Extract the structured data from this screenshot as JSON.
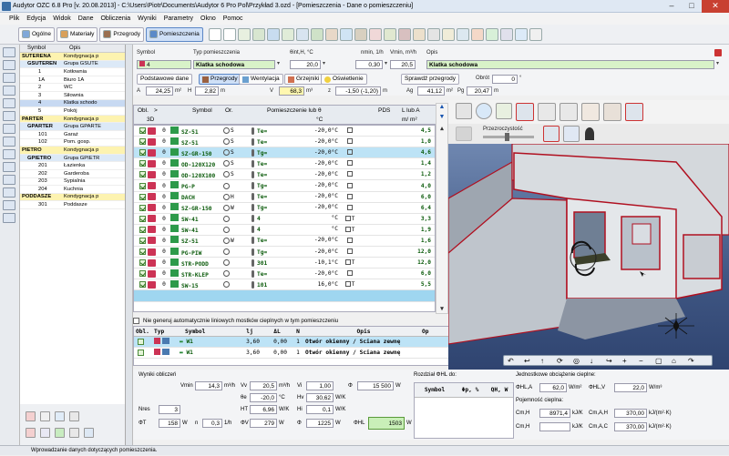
{
  "window": {
    "title": "Audytor OZC 6.8 Pro [v. 20.08.2013] - C:\\Users\\Piotr\\Documents\\Audytor 6 Pro Pol\\Przykład 3.ozd - [Pomieszczenia - Dane o pomieszczeniu]"
  },
  "menu": [
    "Plik",
    "Edycja",
    "Widok",
    "Dane",
    "Obliczenia",
    "Wyniki",
    "Parametry",
    "Okno",
    "Pomoc"
  ],
  "toolbar": {
    "tabs": [
      "Ogólne",
      "Materiały",
      "Przegrody",
      "Pomieszczenia"
    ],
    "active_tab": "Pomieszczenia",
    "zoom": "7 : 28"
  },
  "tree": {
    "col_symbol": "Symbol",
    "col_opis": "Opis",
    "rows": [
      {
        "level": 0,
        "symbol": "SUTERENA",
        "opis": "Kondygnacja p"
      },
      {
        "level": 1,
        "symbol": "GSUTEREN",
        "opis": "Grupa GSUTE"
      },
      {
        "level": 2,
        "symbol": "1",
        "opis": "Kotłownia"
      },
      {
        "level": 2,
        "symbol": "1A",
        "opis": "Biuro 1A"
      },
      {
        "level": 2,
        "symbol": "2",
        "opis": "WC"
      },
      {
        "level": 2,
        "symbol": "3",
        "opis": "Siłownia"
      },
      {
        "level": 2,
        "symbol": "4",
        "opis": "Klatka schodo",
        "selected": true
      },
      {
        "level": 2,
        "symbol": "5",
        "opis": "Pokój"
      },
      {
        "level": 0,
        "symbol": "PARTER",
        "opis": "Kondygnacja p"
      },
      {
        "level": 1,
        "symbol": "GPARTER",
        "opis": "Grupa GPARTE"
      },
      {
        "level": 2,
        "symbol": "101",
        "opis": "Garaż"
      },
      {
        "level": 2,
        "symbol": "102",
        "opis": "Pom. gosp."
      },
      {
        "level": 0,
        "symbol": "PIETRO",
        "opis": "Kondygnacja p"
      },
      {
        "level": 1,
        "symbol": "GPIETRO",
        "opis": "Grupa GPIETR"
      },
      {
        "level": 2,
        "symbol": "201",
        "opis": "Łazienka"
      },
      {
        "level": 2,
        "symbol": "202",
        "opis": "Garderoba"
      },
      {
        "level": 2,
        "symbol": "203",
        "opis": "Sypialnia"
      },
      {
        "level": 2,
        "symbol": "204",
        "opis": "Kuchnia"
      },
      {
        "level": 0,
        "symbol": "PODDASZE",
        "opis": "Kondygnacja p"
      },
      {
        "level": 2,
        "symbol": "301",
        "opis": "Poddasze"
      }
    ]
  },
  "room_form": {
    "lbl_symbol": "Symbol",
    "symbol": "4",
    "lbl_typ": "Typ pomieszczenia",
    "typ": "Klatka schodowa",
    "lbl_theta": "θint,H, °C",
    "theta": "20,0",
    "lbl_nmin": "nmin, 1/h",
    "nmin": "0,30",
    "lbl_vmin": "Vmin, m³/h",
    "vmin": "20,5",
    "lbl_opis": "Opis",
    "opis": "Klatka schodowa",
    "btn_podst": "Podstawowe dane",
    "btn_przegrody": "Przegrody",
    "btn_went": "Wentylacja",
    "btn_grzejniki": "Grzejniki",
    "btn_oswietlenie": "Oświetlenie",
    "btn_sprawdz": "Sprawdź przegrody",
    "lbl_obrot": "Obrót",
    "obrot": "0",
    "lbl_A": "A",
    "A": "24,25",
    "u_m2": "m²",
    "lbl_H": "H",
    "H": "2,82",
    "lbl_V": "V",
    "V": "68,3",
    "u_m3": "m³",
    "lbl_z": "z",
    "z": "-1,50 (-1,20)",
    "lbl_Ag": "Ag",
    "Ag": "41,12",
    "lbl_Pg": "Pg",
    "Pg": "20,47",
    "u_m": "m"
  },
  "partitions": {
    "hdr_obl": "Obl.",
    "hdr_arrow": ">",
    "hdr_3d": "3D",
    "hdr_symbol": "Symbol",
    "hdr_or": "Or.",
    "hdr_adj": "Pomieszczenie lub θ",
    "hdr_unit": "°C",
    "hdr_pds": "PDS",
    "hdr_l": "L lub A",
    "hdr_l_unit": "m/ m²",
    "rows": [
      {
        "n": "0",
        "sym": "SZ-51",
        "or": "S",
        "adj": "Te=",
        "theta": "-20,0°C",
        "pds": "",
        "val": "4,5",
        "style": ""
      },
      {
        "n": "0",
        "sym": "SZ-51",
        "or": "S",
        "adj": "Te=",
        "theta": "-20,0°C",
        "pds": "",
        "val": "1,0",
        "style": ""
      },
      {
        "n": "0",
        "sym": "SZ-GR-150",
        "or": "S",
        "adj": "Tg=",
        "theta": "-20,0°C",
        "pds": "",
        "val": "4,6",
        "style": "hl"
      },
      {
        "n": "0",
        "sym": "OD-120X120",
        "or": "S",
        "adj": "Te=",
        "theta": "-20,0°C",
        "pds": "",
        "val": "1,4",
        "style": ""
      },
      {
        "n": "0",
        "sym": "OD-120X100",
        "or": "S",
        "adj": "Te=",
        "theta": "-20,0°C",
        "pds": "",
        "val": "1,2",
        "style": ""
      },
      {
        "n": "0",
        "sym": "PG-P",
        "or": "",
        "adj": "Tg=",
        "theta": "-20,0°C",
        "pds": "",
        "val": "4,0",
        "style": ""
      },
      {
        "n": "0",
        "sym": "DACH",
        "or": "H",
        "adj": "Te=",
        "theta": "-20,0°C",
        "pds": "",
        "val": "6,0",
        "style": ""
      },
      {
        "n": "0",
        "sym": "SZ-GR-150",
        "or": "W",
        "adj": "Tg=",
        "theta": "-20,0°C",
        "pds": "",
        "val": "6,4",
        "style": ""
      },
      {
        "n": "0",
        "sym": "SW-41",
        "or": "",
        "adj": "4",
        "theta": "°C",
        "pds": "T",
        "val": "3,3",
        "style": ""
      },
      {
        "n": "0",
        "sym": "SW-41",
        "or": "",
        "adj": "4",
        "theta": "°C",
        "pds": "T",
        "val": "1,9",
        "style": ""
      },
      {
        "n": "0",
        "sym": "SZ-51",
        "or": "W",
        "adj": "Te=",
        "theta": "-20,0°C",
        "pds": "",
        "val": "1,6",
        "style": ""
      },
      {
        "n": "0",
        "sym": "PG-PIW",
        "or": "",
        "adj": "Tg=",
        "theta": "-20,0°C",
        "pds": "",
        "val": "12,0",
        "style": ""
      },
      {
        "n": "0",
        "sym": "STR-PODD",
        "or": "",
        "adj": "301",
        "theta": "-10,1°C",
        "pds": "T",
        "val": "12,0",
        "style": ""
      },
      {
        "n": "0",
        "sym": "STR-KLEP",
        "or": "",
        "adj": "Te=",
        "theta": "-20,0°C",
        "pds": "",
        "val": "6,0",
        "style": ""
      },
      {
        "n": "0",
        "sym": "SW-15",
        "or": "",
        "adj": "101",
        "theta": "16,0°C",
        "pds": "T",
        "val": "5,5",
        "style": ""
      },
      {
        "n": "0",
        "sym": "",
        "or": "",
        "adj": "",
        "theta": "",
        "pds": "",
        "val": "",
        "style": "hl2"
      }
    ]
  },
  "bridges": {
    "checkbox_label": "Nie generuj automatycznie liniowych mostków cieplnych w tym pomieszczeniu",
    "hdr_obl": "Obl.",
    "hdr_typ": "Typ",
    "hdr_symbol": "Symbol",
    "hdr_l": "lj",
    "hdr_dl": "ΔL",
    "hdr_n": "N",
    "hdr_op": "Opis",
    "hdr_op_short": "Op",
    "rows": [
      {
        "sym": "W1",
        "l": "3,60",
        "dl": "0,00",
        "n": "1",
        "op": "Otwór okienny / Ściana zewnę"
      },
      {
        "sym": "W1",
        "l": "3,60",
        "dl": "0,00",
        "n": "1",
        "op": "Otwór okienny / Ściana zewnę"
      }
    ]
  },
  "viewer": {
    "transparency_label": "Przezroczystość"
  },
  "results": {
    "section_title": "Wyniki obliczeń",
    "lbl_vmin": "Vmin",
    "vmin": "14,3",
    "u_m3h": "m³/h",
    "lbl_vv": "Vv",
    "vv": "20,5",
    "lbl_vi": "Vi",
    "vi": "1,00",
    "lbl_phi1": "Φ",
    "phi1": "15 500",
    "u_w": "W",
    "lbl_theta_e": "θe",
    "theta_e": "-20,0",
    "u_c": "°C",
    "lbl_hv": "Hv",
    "hv": "30,62",
    "u_wk": "W/K",
    "lbl_nres": "Nres",
    "nres": "3",
    "lbl_ht": "HT",
    "ht": "6,96",
    "lbl_hi": "Hi",
    "hi": "0,1",
    "lbl_phit": "ΦT",
    "phit": "158",
    "lbl_n": "n",
    "n": "0,3",
    "u_1h": "1/h",
    "lbl_phiv": "ΦV",
    "phiv": "279",
    "lbl_phi2": "Φ",
    "phi2": "1225",
    "lbl_phihl": "ΦHL",
    "phihl": "1503",
    "dist_title": "Rozdział ΦHL do:",
    "dist_hdr_symbol": "Symbol",
    "dist_hdr_phi": "Φp, %",
    "dist_hdr_qh": "QH, W",
    "unit_title": "Jednostkowe obciążenie cieplne:",
    "lbl_phiha": "ΦHL,A",
    "phiha": "62,0",
    "u_wm2": "W/m²",
    "lbl_phihv": "ΦHL,V",
    "phihv": "22,0",
    "u_wm3": "W/m³",
    "cap_title": "Pojemność cieplna:",
    "lbl_cm": "Cm,H",
    "cm": "8971,4",
    "u_kjk": "kJ/K",
    "lbl_cma": "Cm,A,H",
    "cma": "370,00",
    "u_kjm2k": "kJ/(m²·K)",
    "lbl_cm2": "Cm,H",
    "cm2": "",
    "lbl_cmv": "Cm,A,C",
    "cmv": "370,00"
  },
  "status": {
    "text": "Wprowadzanie danych dotyczących pomieszczenia."
  },
  "colors": {
    "accent": "#3a6ea5",
    "highlight": "#bde3f6",
    "green": "#c9efb8",
    "wall_red": "#b01020"
  }
}
